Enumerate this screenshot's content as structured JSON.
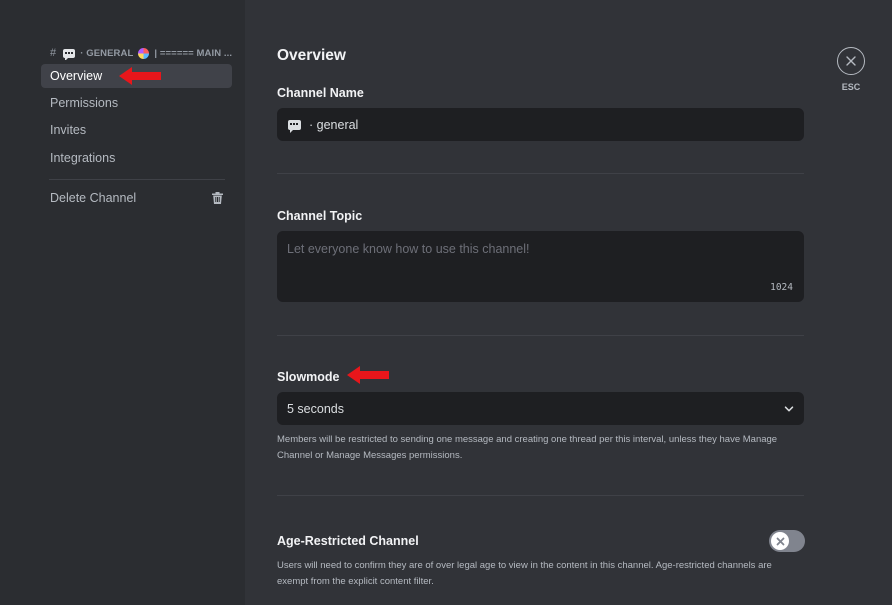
{
  "sidebar": {
    "header": {
      "hash": "#",
      "channel": "· GENERAL",
      "category": "| ====== MAIN ..."
    },
    "items": [
      {
        "label": "Overview",
        "selected": true
      },
      {
        "label": "Permissions"
      },
      {
        "label": "Invites"
      },
      {
        "label": "Integrations"
      }
    ],
    "delete_label": "Delete Channel"
  },
  "main": {
    "title": "Overview",
    "channel_name": {
      "label": "Channel Name",
      "value": "· general"
    },
    "channel_topic": {
      "label": "Channel Topic",
      "placeholder": "Let everyone know how to use this channel!",
      "char_count": "1024"
    },
    "slowmode": {
      "label": "Slowmode",
      "value": "5 seconds",
      "help": "Members will be restricted to sending one message and creating one thread per this interval, unless they have Manage Channel or Manage Messages permissions."
    },
    "age_restricted": {
      "label": "Age-Restricted Channel",
      "enabled": false,
      "help": "Users will need to confirm they are of over legal age to view in the content in this channel. Age-restricted channels are exempt from the explicit content filter."
    }
  },
  "close": {
    "label": "ESC"
  },
  "colors": {
    "background": "#313338",
    "sidebar": "#2b2d31",
    "input": "#1e1f22",
    "selected": "#404249",
    "annotation_arrow": "#e8161b"
  }
}
